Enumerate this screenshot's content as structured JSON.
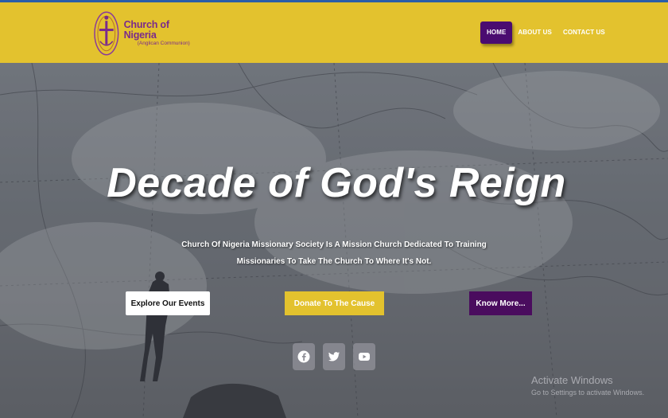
{
  "header": {
    "logo": {
      "name": "Church of Nigeria",
      "subtitle": "(Anglican Communion)"
    },
    "nav": [
      {
        "label": "HOME",
        "active": true
      },
      {
        "label": "ABOUT US",
        "active": false
      },
      {
        "label": "CONTACT US",
        "active": false
      }
    ]
  },
  "hero": {
    "headline": "Decade of God's Reign",
    "tagline": "Church Of Nigeria Missionary Society Is A Mission Church Dedicated To Training Missionaries To Take The Church To Where It's Not.",
    "buttons": {
      "events": "Explore Our Events",
      "donate": "Donate To The Cause",
      "know_more": "Know More..."
    },
    "social": [
      "facebook-icon",
      "twitter-icon",
      "youtube-icon"
    ]
  },
  "watermark": {
    "title": "Activate Windows",
    "subtitle": "Go to Settings to activate Windows."
  },
  "colors": {
    "header_bg": "#e3c22e",
    "brand_purple": "#4a0c70",
    "top_line": "#2a5ea8"
  }
}
